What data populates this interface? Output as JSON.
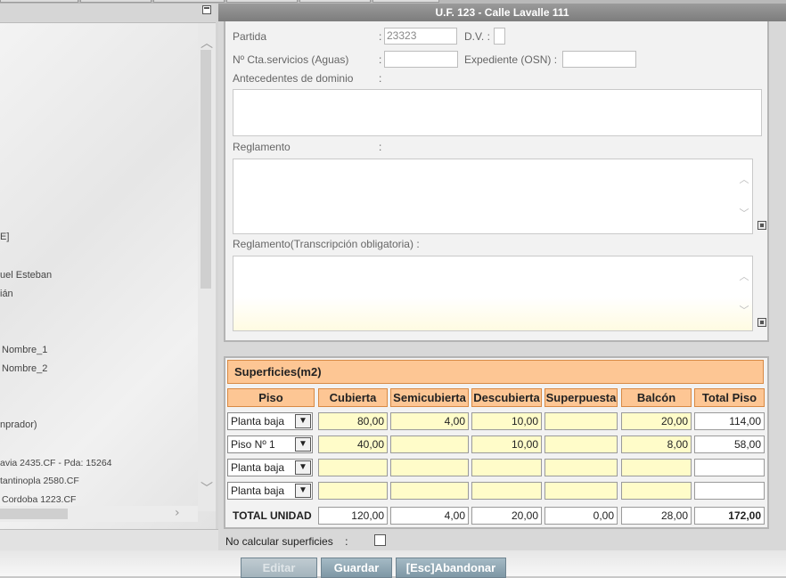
{
  "window_title": "U.F. 123 - Calle Lavalle 111",
  "left_panel": {
    "texts": [
      "E]",
      "uel Esteban",
      "ián",
      "Nombre_1",
      "Nombre_2",
      "nprador)",
      "avia 2435.CF - Pda: 15264",
      "tantinopla 2580.CF",
      "Cordoba 1223.CF"
    ]
  },
  "form": {
    "partida_label": "Partida",
    "partida_value": "23323",
    "dv_label": "D.V. :",
    "dv_value": "",
    "cta_label": "Nº Cta.servicios (Aguas)",
    "cta_value": "",
    "expediente_label": "Expediente (OSN) :",
    "expediente_value": "",
    "antecedentes_label": "Antecedentes de dominio",
    "reglamento_label": "Reglamento",
    "reglamento_trans_label": "Reglamento(Transcripción obligatoria) :",
    "colon": ":"
  },
  "surfaces": {
    "title": "Superficies(m2)",
    "headers": [
      "Piso",
      "Cubierta",
      "Semicubierta",
      "Descubierta",
      "Superpuesta",
      "Balcón",
      "Total Piso"
    ],
    "rows": [
      {
        "piso": "Planta baja",
        "values": [
          "80,00",
          "4,00",
          "10,00",
          "",
          "20,00",
          "114,00"
        ]
      },
      {
        "piso": "Piso Nº 1",
        "values": [
          "40,00",
          "",
          "10,00",
          "",
          "8,00",
          "58,00"
        ]
      },
      {
        "piso": "Planta baja",
        "values": [
          "",
          "",
          "",
          "",
          "",
          ""
        ]
      },
      {
        "piso": "Planta baja",
        "values": [
          "",
          "",
          "",
          "",
          "",
          ""
        ]
      }
    ],
    "total_label": "TOTAL UNIDAD",
    "totals": [
      "120,00",
      "4,00",
      "20,00",
      "0,00",
      "28,00",
      "172,00"
    ],
    "no_calc_label": "No calcular superficies",
    "no_calc_colon": ":",
    "no_calc_checked": false
  },
  "buttons": {
    "editar": "Editar",
    "guardar": "Guardar",
    "abandonar": "[Esc]Abandonar"
  },
  "colors": {
    "header_orange": "#fdc694",
    "cell_yellow": "#fffcc9",
    "button_blue": "#7e97a5",
    "titlebar_grey": "#8a8a8a"
  }
}
